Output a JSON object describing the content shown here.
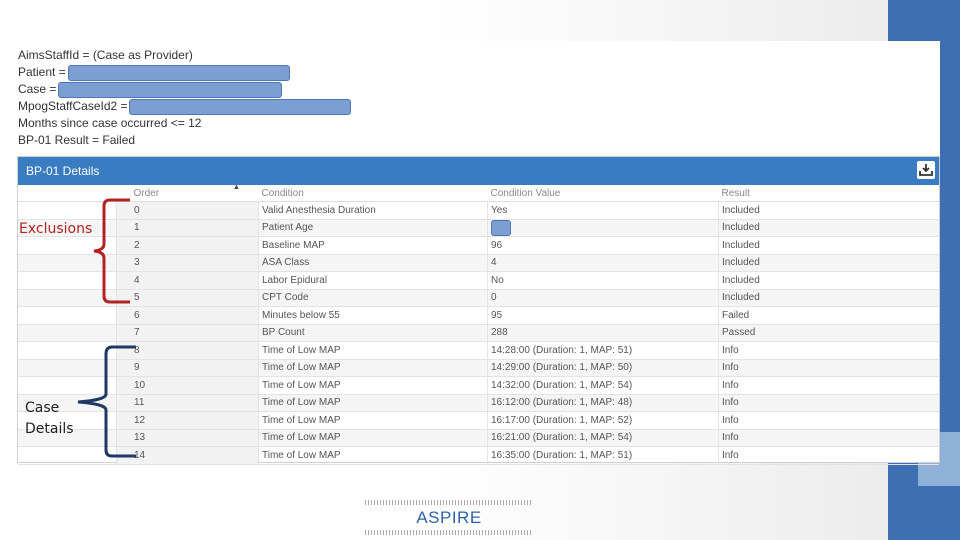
{
  "filters": {
    "aims_staff_id": "AimsStaffId = (Case as Provider)",
    "patient": "Patient =",
    "case": "Case =",
    "mpog_staff": "MpogStaffCaseId2 =",
    "months": "Months since case occurred <= 12",
    "result": "BP-01 Result = Failed"
  },
  "panel": {
    "title": "BP-01 Details",
    "columns": [
      "Order",
      "Condition",
      "Condition Value",
      "Result"
    ],
    "rows": [
      {
        "order": "0",
        "condition": "Valid Anesthesia Duration",
        "value": "Yes",
        "result": "Included"
      },
      {
        "order": "1",
        "condition": "Patient Age",
        "value": "",
        "result": "Included"
      },
      {
        "order": "2",
        "condition": "Baseline MAP",
        "value": "96",
        "result": "Included"
      },
      {
        "order": "3",
        "condition": "ASA Class",
        "value": "4",
        "result": "Included"
      },
      {
        "order": "4",
        "condition": "Labor Epidural",
        "value": "No",
        "result": "Included"
      },
      {
        "order": "5",
        "condition": "CPT Code",
        "value": "0",
        "result": "Included"
      },
      {
        "order": "6",
        "condition": "Minutes below 55",
        "value": "95",
        "result": "Failed"
      },
      {
        "order": "7",
        "condition": "BP Count",
        "value": "288",
        "result": "Passed"
      },
      {
        "order": "8",
        "condition": "Time of Low MAP",
        "value": "14:28:00 (Duration: 1, MAP: 51)",
        "result": "Info"
      },
      {
        "order": "9",
        "condition": "Time of Low MAP",
        "value": "14:29:00 (Duration: 1, MAP: 50)",
        "result": "Info"
      },
      {
        "order": "10",
        "condition": "Time of Low MAP",
        "value": "14:32:00 (Duration: 1, MAP: 54)",
        "result": "Info"
      },
      {
        "order": "11",
        "condition": "Time of Low MAP",
        "value": "16:12:00 (Duration: 1, MAP: 48)",
        "result": "Info"
      },
      {
        "order": "12",
        "condition": "Time of Low MAP",
        "value": "16:17:00 (Duration: 1, MAP: 52)",
        "result": "Info"
      },
      {
        "order": "13",
        "condition": "Time of Low MAP",
        "value": "16:21:00 (Duration: 1, MAP: 54)",
        "result": "Info"
      },
      {
        "order": "14",
        "condition": "Time of Low MAP",
        "value": "16:35:00 (Duration: 1, MAP: 51)",
        "result": "Info"
      }
    ]
  },
  "annotations": {
    "exclusions": "Exclusions",
    "case_line1": "Case",
    "case_line2": "Details",
    "exclusions_color": "#b22222",
    "case_color": "#1f3864"
  },
  "logo": {
    "text": "ASPIRE"
  },
  "colors": {
    "header": "#3a7cc2",
    "redaction": "#7b9fd3",
    "accent_bar": "#3e6fb3"
  }
}
